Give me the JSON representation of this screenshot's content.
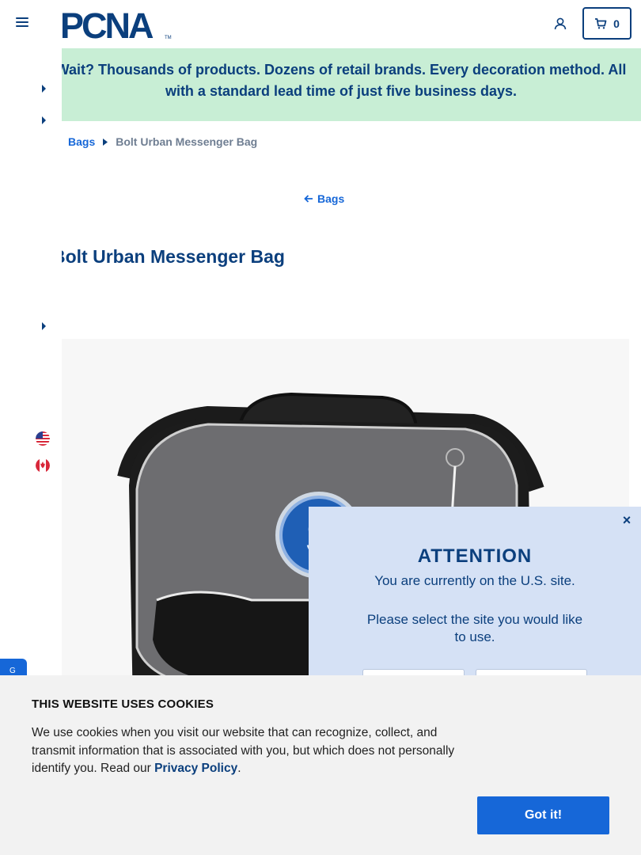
{
  "header": {
    "logo_text": "PCNA",
    "logo_tm": "TM",
    "cart_count": "0",
    "colors": {
      "brand": "#0b3f7d",
      "accent": "#1667d8"
    }
  },
  "banner": {
    "text": "Wait? Thousands of products. Dozens of retail brands. Every decoration method. All with a standard lead time of just five business days.",
    "background": "#c8eed5"
  },
  "breadcrumb": {
    "parent": "Bags",
    "current": "Bolt Urban Messenger Bag"
  },
  "back_link": {
    "label": "Bags"
  },
  "product": {
    "title": "Bolt Urban Messenger Bag"
  },
  "left_rail": {
    "flags": [
      "us-flag-icon",
      "canada-flag-icon"
    ],
    "feedback_label": "G"
  },
  "modal": {
    "title": "ATTENTION",
    "line1": "You are currently on the U.S. site.",
    "line2": "Please select the site you would like to use.",
    "close_label": "×"
  },
  "cookie": {
    "title": "THIS WEBSITE USES COOKIES",
    "text_before": "We use cookies when you visit our website that can recognize, collect, and transmit information that is associated with you, but which does not personally identify you. Read our ",
    "link": "Privacy Policy",
    "text_after": ".",
    "button": "Got it!"
  }
}
